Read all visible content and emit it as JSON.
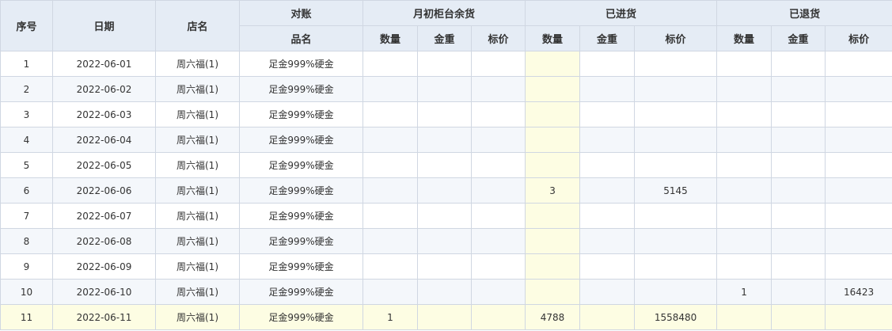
{
  "header": {
    "seq": "序号",
    "date": "日期",
    "store": "店名",
    "reconcile": "对账",
    "product": "品名",
    "group_opening": "月初柜台余货",
    "group_received": "已进货",
    "group_returned": "已退货",
    "qty": "数量",
    "weight": "金重",
    "price": "标价"
  },
  "rows": [
    {
      "seq": "1",
      "date": "2022-06-01",
      "store": "周六福(1)",
      "product": "足金999%硬金",
      "open_qty": "",
      "open_wt": "",
      "open_price": "",
      "in_qty": "",
      "in_wt": "",
      "in_price": "",
      "ret_qty": "",
      "ret_wt": "",
      "ret_price": ""
    },
    {
      "seq": "2",
      "date": "2022-06-02",
      "store": "周六福(1)",
      "product": "足金999%硬金",
      "open_qty": "",
      "open_wt": "",
      "open_price": "",
      "in_qty": "",
      "in_wt": "",
      "in_price": "",
      "ret_qty": "",
      "ret_wt": "",
      "ret_price": ""
    },
    {
      "seq": "3",
      "date": "2022-06-03",
      "store": "周六福(1)",
      "product": "足金999%硬金",
      "open_qty": "",
      "open_wt": "",
      "open_price": "",
      "in_qty": "",
      "in_wt": "",
      "in_price": "",
      "ret_qty": "",
      "ret_wt": "",
      "ret_price": ""
    },
    {
      "seq": "4",
      "date": "2022-06-04",
      "store": "周六福(1)",
      "product": "足金999%硬金",
      "open_qty": "",
      "open_wt": "",
      "open_price": "",
      "in_qty": "",
      "in_wt": "",
      "in_price": "",
      "ret_qty": "",
      "ret_wt": "",
      "ret_price": ""
    },
    {
      "seq": "5",
      "date": "2022-06-05",
      "store": "周六福(1)",
      "product": "足金999%硬金",
      "open_qty": "",
      "open_wt": "",
      "open_price": "",
      "in_qty": "",
      "in_wt": "",
      "in_price": "",
      "ret_qty": "",
      "ret_wt": "",
      "ret_price": ""
    },
    {
      "seq": "6",
      "date": "2022-06-06",
      "store": "周六福(1)",
      "product": "足金999%硬金",
      "open_qty": "",
      "open_wt": "",
      "open_price": "",
      "in_qty": "3",
      "in_wt": "",
      "in_price": "5145",
      "ret_qty": "",
      "ret_wt": "",
      "ret_price": ""
    },
    {
      "seq": "7",
      "date": "2022-06-07",
      "store": "周六福(1)",
      "product": "足金999%硬金",
      "open_qty": "",
      "open_wt": "",
      "open_price": "",
      "in_qty": "",
      "in_wt": "",
      "in_price": "",
      "ret_qty": "",
      "ret_wt": "",
      "ret_price": ""
    },
    {
      "seq": "8",
      "date": "2022-06-08",
      "store": "周六福(1)",
      "product": "足金999%硬金",
      "open_qty": "",
      "open_wt": "",
      "open_price": "",
      "in_qty": "",
      "in_wt": "",
      "in_price": "",
      "ret_qty": "",
      "ret_wt": "",
      "ret_price": ""
    },
    {
      "seq": "9",
      "date": "2022-06-09",
      "store": "周六福(1)",
      "product": "足金999%硬金",
      "open_qty": "",
      "open_wt": "",
      "open_price": "",
      "in_qty": "",
      "in_wt": "",
      "in_price": "",
      "ret_qty": "",
      "ret_wt": "",
      "ret_price": ""
    },
    {
      "seq": "10",
      "date": "2022-06-10",
      "store": "周六福(1)",
      "product": "足金999%硬金",
      "open_qty": "",
      "open_wt": "",
      "open_price": "",
      "in_qty": "",
      "in_wt": "",
      "in_price": "",
      "ret_qty": "1",
      "ret_wt": "",
      "ret_price": "16423"
    },
    {
      "seq": "11",
      "date": "2022-06-11",
      "store": "周六福(1)",
      "product": "足金999%硬金",
      "open_qty": "1",
      "open_wt": "",
      "open_price": "",
      "in_qty": "4788",
      "in_wt": "",
      "in_price": "1558480",
      "ret_qty": "",
      "ret_wt": "",
      "ret_price": ""
    }
  ],
  "colors": {
    "header_bg": "#e5ecf5",
    "border": "#d0d7e2",
    "row_alt": "#f4f7fb",
    "highlight": "#fdfde3"
  },
  "selected_row": "11"
}
